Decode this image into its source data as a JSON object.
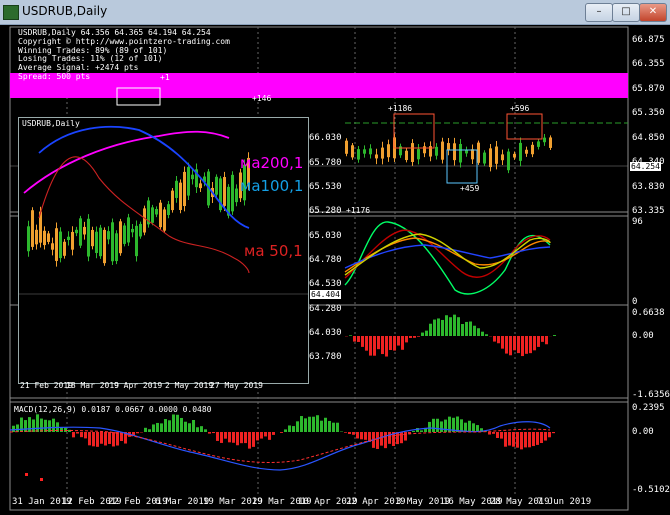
{
  "window": {
    "title": "USDRUB,Daily",
    "minimize_icon": "minimize-icon",
    "restore_icon": "restore-icon",
    "close_icon": "close-icon",
    "min_label": "–",
    "max_label": "□",
    "close_label": "✕"
  },
  "header": {
    "symbol_line": "USDRUB,Daily 64.356 64.365 64.194 64.254",
    "copyright": "Copyright © http://www.pointzero-trading.com",
    "winning": "Winning Trades: 89% (89 of 101)",
    "losing": "Losing Trades: 11% (12 of 101)",
    "avg_signal": "Average Signal: +2474 pts",
    "spread": "Spread: 500 pts"
  },
  "main_axis": {
    "labels": [
      "66.875",
      "66.355",
      "65.870",
      "65.350",
      "64.850",
      "64.340",
      "63.830",
      "63.335"
    ],
    "current_price": "64.254"
  },
  "osc_axis": {
    "top": "96",
    "bottom": "0"
  },
  "hist_axis": {
    "top": "0.6638",
    "zero": "0.00",
    "bottom": "-1.6356"
  },
  "macd": {
    "label": "MACD(12,26,9) 0.0187 0.0667 0.0000 0.0480",
    "top": "0.2395",
    "zero": "0.00",
    "bottom": "-0.5102"
  },
  "dates": [
    "31 Jan 2019",
    "12 Feb 2019",
    "22 Feb 2019",
    "6 Mar 2019",
    "19 Mar 2019",
    "29 Mar 2019",
    "10 Apr 2019",
    "22 Apr 2019",
    "3 May 2019",
    "16 May 2019",
    "28 May 2019",
    "7 Jun 2019"
  ],
  "annotations": {
    "a1": "+1186",
    "a2": "+596",
    "a3": "+459",
    "a4": "+1176",
    "a5": "+1",
    "a6": "+146"
  },
  "inner": {
    "title": "USDRUB,Daily",
    "axis": [
      "66.030",
      "65.780",
      "65.530",
      "65.280",
      "65.030",
      "64.780",
      "64.530",
      "64.280",
      "64.030",
      "63.780"
    ],
    "current_price": "64.404",
    "ma200": "ма200,1",
    "ma100": "ма100,1",
    "ma50": "ма 50,1",
    "dates": [
      "21 Feb 2019",
      "18 Mar 2019",
      "9 Apr 2019",
      "2 May 2019",
      "27 May 2019"
    ]
  },
  "colors": {
    "magenta": "#ff00ff",
    "blue": "#1a44ff",
    "red": "#dd2222",
    "cyan": "#14a0e6",
    "green": "#2db82d",
    "orange": "#f0a030",
    "bg": "#000000"
  }
}
